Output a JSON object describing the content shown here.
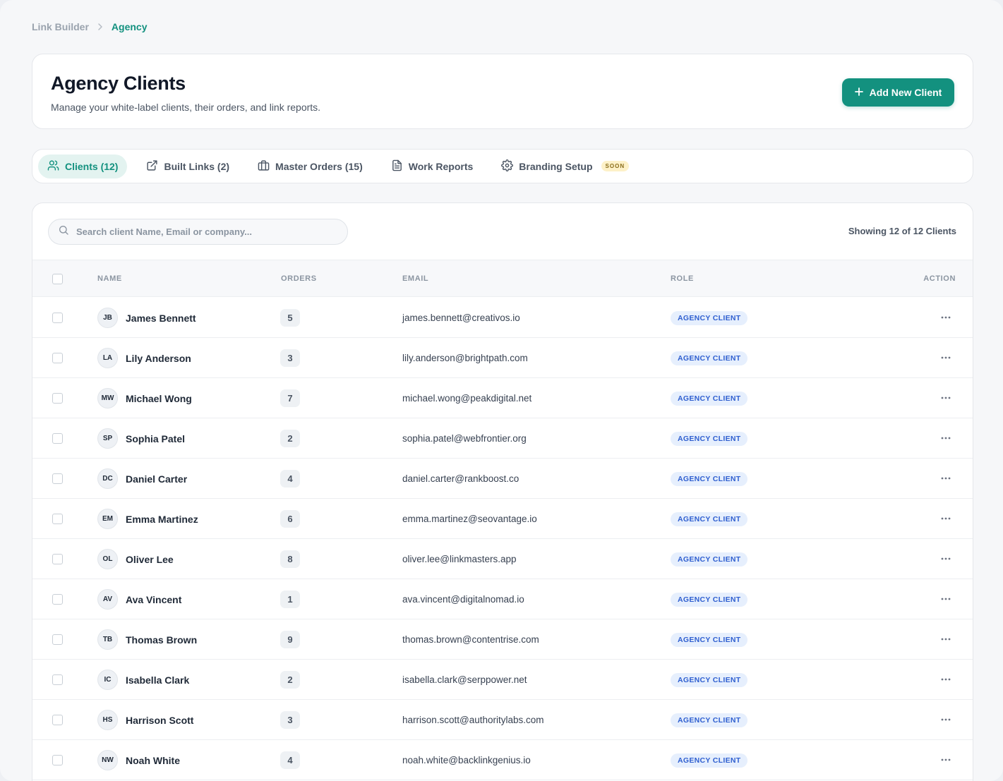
{
  "breadcrumb": {
    "root": "Link Builder",
    "current": "Agency"
  },
  "header": {
    "title": "Agency Clients",
    "subtitle": "Manage your white-label clients, their orders, and link reports.",
    "add_button": "Add New Client"
  },
  "tabs": [
    {
      "label": "Clients (12)",
      "icon": "users-icon",
      "active": true
    },
    {
      "label": "Built Links (2)",
      "icon": "external-link-icon",
      "active": false
    },
    {
      "label": "Master Orders (15)",
      "icon": "briefcase-icon",
      "active": false
    },
    {
      "label": "Work Reports",
      "icon": "document-icon",
      "active": false
    },
    {
      "label": "Branding Setup",
      "icon": "gear-icon",
      "active": false,
      "badge": "SOON"
    }
  ],
  "search": {
    "placeholder": "Search client Name, Email or company..."
  },
  "showing": "Showing 12 of 12 Clients",
  "table": {
    "columns": {
      "name": "NAME",
      "orders": "ORDERS",
      "email": "EMAIL",
      "role": "ROLE",
      "action": "ACTION"
    },
    "rows": [
      {
        "initials": "JB",
        "name": "James Bennett",
        "orders": "5",
        "email": "james.bennett@creativos.io",
        "role": "AGENCY CLIENT"
      },
      {
        "initials": "LA",
        "name": "Lily Anderson",
        "orders": "3",
        "email": "lily.anderson@brightpath.com",
        "role": "AGENCY CLIENT"
      },
      {
        "initials": "MW",
        "name": "Michael Wong",
        "orders": "7",
        "email": "michael.wong@peakdigital.net",
        "role": "AGENCY CLIENT"
      },
      {
        "initials": "SP",
        "name": "Sophia Patel",
        "orders": "2",
        "email": "sophia.patel@webfrontier.org",
        "role": "AGENCY CLIENT"
      },
      {
        "initials": "DC",
        "name": "Daniel Carter",
        "orders": "4",
        "email": "daniel.carter@rankboost.co",
        "role": "AGENCY CLIENT"
      },
      {
        "initials": "EM",
        "name": "Emma Martinez",
        "orders": "6",
        "email": "emma.martinez@seovantage.io",
        "role": "AGENCY CLIENT"
      },
      {
        "initials": "OL",
        "name": "Oliver Lee",
        "orders": "8",
        "email": "oliver.lee@linkmasters.app",
        "role": "AGENCY CLIENT"
      },
      {
        "initials": "AV",
        "name": "Ava Vincent",
        "orders": "1",
        "email": "ava.vincent@digitalnomad.io",
        "role": "AGENCY CLIENT"
      },
      {
        "initials": "TB",
        "name": "Thomas Brown",
        "orders": "9",
        "email": "thomas.brown@contentrise.com",
        "role": "AGENCY CLIENT"
      },
      {
        "initials": "IC",
        "name": "Isabella Clark",
        "orders": "2",
        "email": "isabella.clark@serppower.net",
        "role": "AGENCY CLIENT"
      },
      {
        "initials": "HS",
        "name": "Harrison Scott",
        "orders": "3",
        "email": "harrison.scott@authoritylabs.com",
        "role": "AGENCY CLIENT"
      },
      {
        "initials": "NW",
        "name": "Noah White",
        "orders": "4",
        "email": "noah.white@backlinkgenius.io",
        "role": "AGENCY CLIENT"
      }
    ]
  },
  "colors": {
    "accent": "#13917f",
    "role_badge_bg": "#e6effd",
    "role_badge_text": "#2f5fd0",
    "soon_badge_bg": "#fdf1c8"
  }
}
